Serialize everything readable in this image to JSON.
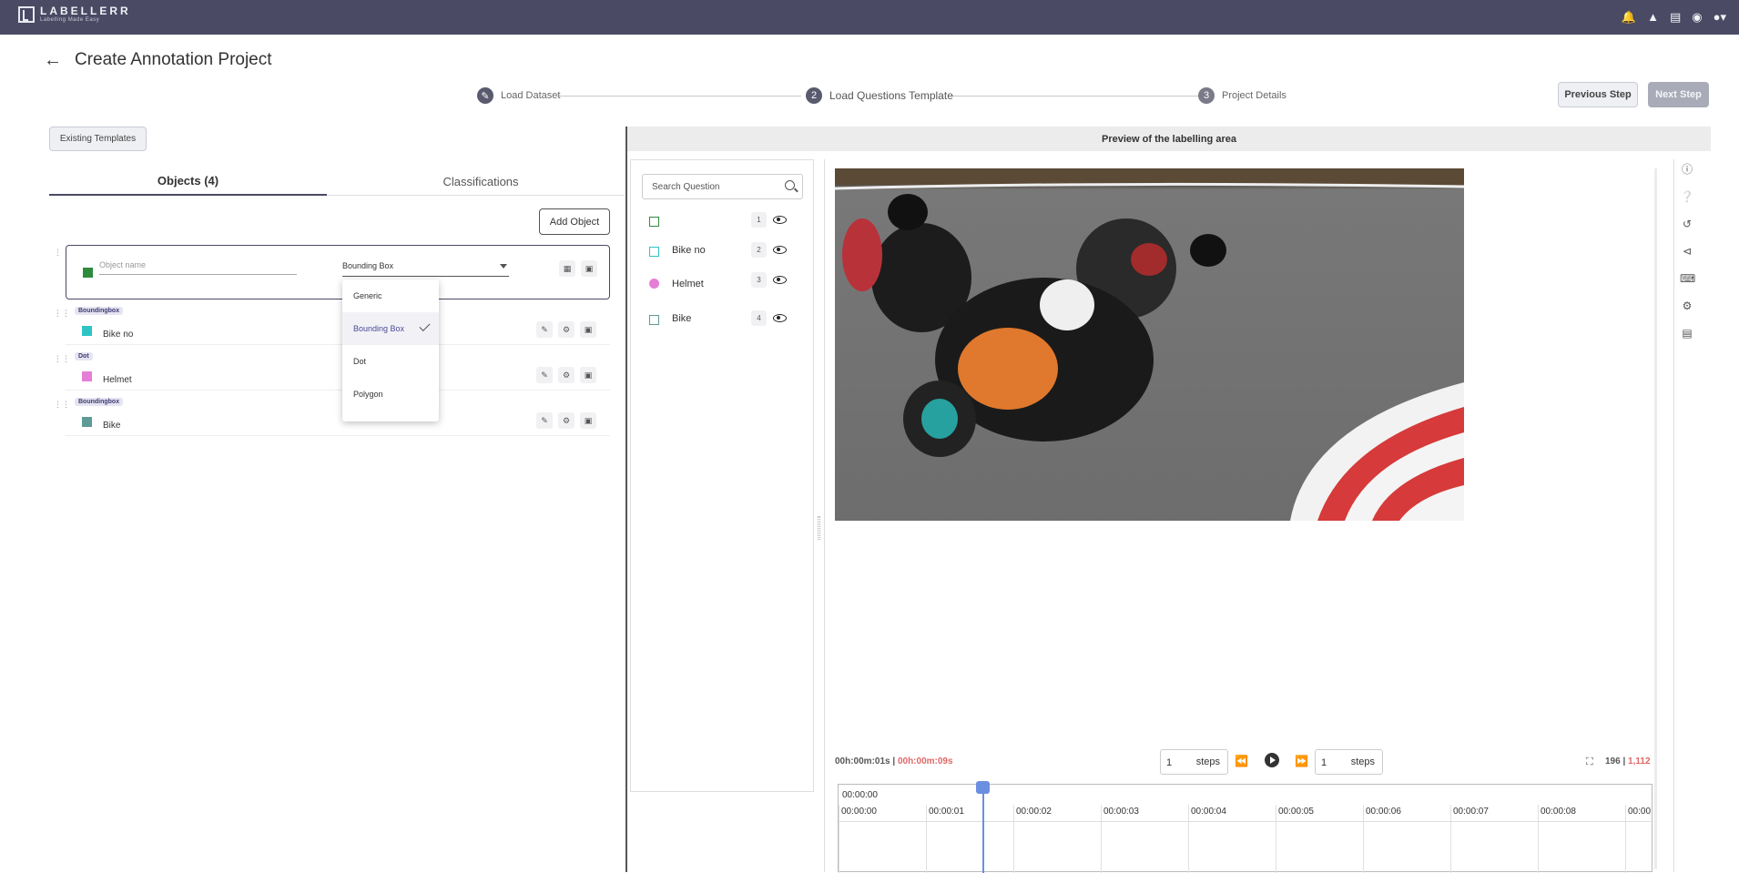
{
  "app": {
    "logo_text": "LABELLERR",
    "logo_tagline": "Labelling Made Easy",
    "top_icons": [
      "bell-icon",
      "hierarchy-icon",
      "book-icon",
      "headset-icon",
      "user-icon"
    ]
  },
  "page": {
    "title": "Create Annotation Project"
  },
  "stepper": {
    "steps": [
      {
        "number": "",
        "label": "Load Dataset",
        "state": "done"
      },
      {
        "number": "2",
        "label": "Load Questions Template",
        "state": "active"
      },
      {
        "number": "3",
        "label": "Project Details",
        "state": "pending"
      }
    ]
  },
  "actions": {
    "previous_label": "Previous Step",
    "next_label": "Next Step",
    "existing_templates_label": "Existing Templates",
    "add_object_label": "Add Object"
  },
  "tabs": {
    "objects_label": "Objects (4)",
    "classifications_label": "Classifications"
  },
  "object_editor": {
    "name_placeholder": "Object name",
    "type_value": "Bounding Box",
    "color": "#2e8b3c"
  },
  "objects": [
    {
      "badge": "Boundingbox",
      "name": "Bike no",
      "color": "#2ec4c4"
    },
    {
      "badge": "Dot",
      "name": "Helmet",
      "color": "#e57fd6"
    },
    {
      "badge": "Boundingbox",
      "name": "Bike",
      "color": "#5e9a96"
    }
  ],
  "type_dropdown": {
    "options": [
      "Generic",
      "Bounding Box",
      "Dot",
      "Polygon"
    ],
    "selected": "Bounding Box"
  },
  "preview": {
    "header": "Preview of the labelling area",
    "search_placeholder": "Search Question",
    "questions": [
      {
        "label": "",
        "num": "1",
        "shape": "square",
        "color": "#2e8b3c"
      },
      {
        "label": "Bike no",
        "num": "2",
        "shape": "square",
        "color": "#2ec4c4"
      },
      {
        "label": "Helmet",
        "num": "3",
        "shape": "dot",
        "color": "#e57fd6"
      },
      {
        "label": "Bike",
        "num": "4",
        "shape": "square",
        "color": "#5e9a96"
      }
    ]
  },
  "player": {
    "current_time": "00h:00m:01s",
    "separator": " | ",
    "total_time": "00h:00m:09s",
    "step_back_value": "1",
    "step_forward_value": "1",
    "steps_unit": "steps",
    "frame_current": "196",
    "frame_total": "1,112"
  },
  "timeline": {
    "start_label": "00:00:00",
    "ticks": [
      "00:00:00",
      "00:00:01",
      "00:00:02",
      "00:00:03",
      "00:00:04",
      "00:00:05",
      "00:00:06",
      "00:00:07",
      "00:00:08",
      "00:00"
    ],
    "cursor_fraction": 0.11
  },
  "side_tools": [
    "info-icon",
    "help-icon",
    "history-icon",
    "share-icon",
    "keyboard-icon",
    "settings-icon",
    "media-icon"
  ]
}
